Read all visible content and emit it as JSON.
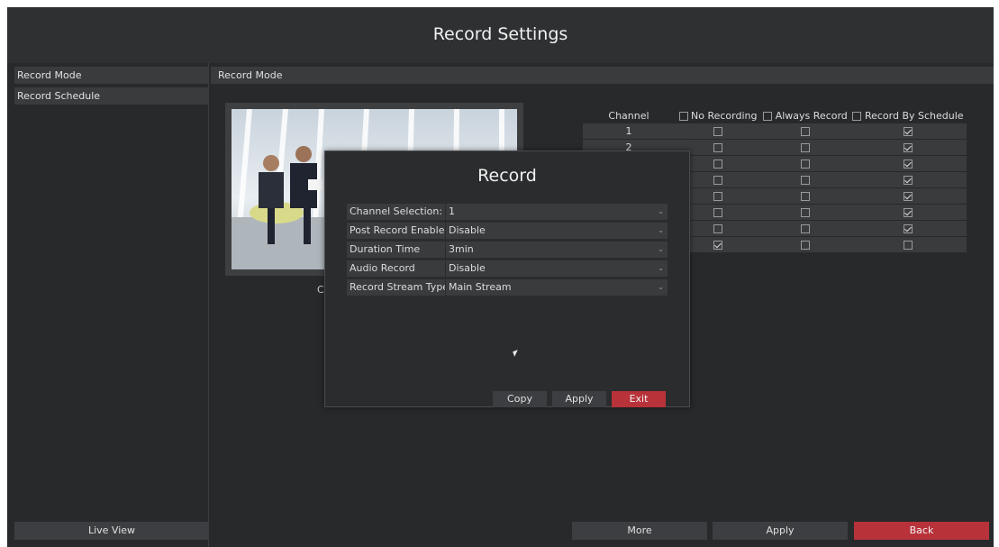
{
  "window": {
    "title": "Record Settings"
  },
  "sidebar": {
    "items": [
      {
        "label": "Record Mode"
      },
      {
        "label": "Record Schedule"
      }
    ],
    "live_view_label": "Live View"
  },
  "panel": {
    "header": "Record Mode",
    "preview_caption": "C"
  },
  "channel_table": {
    "headers": {
      "channel": "Channel",
      "no_recording": "No Recording",
      "always_record": "Always Record",
      "record_by_schedule": "Record By Schedule"
    },
    "rows": [
      {
        "channel": "1",
        "no_recording": false,
        "always_record": false,
        "record_by_schedule": true
      },
      {
        "channel": "2",
        "no_recording": false,
        "always_record": false,
        "record_by_schedule": true
      },
      {
        "channel": "",
        "no_recording": false,
        "always_record": false,
        "record_by_schedule": true
      },
      {
        "channel": "",
        "no_recording": false,
        "always_record": false,
        "record_by_schedule": true
      },
      {
        "channel": "",
        "no_recording": false,
        "always_record": false,
        "record_by_schedule": true
      },
      {
        "channel": "",
        "no_recording": false,
        "always_record": false,
        "record_by_schedule": true
      },
      {
        "channel": "",
        "no_recording": false,
        "always_record": false,
        "record_by_schedule": true
      },
      {
        "channel": "",
        "no_recording": true,
        "always_record": false,
        "record_by_schedule": false
      }
    ]
  },
  "dialog": {
    "title": "Record",
    "fields": [
      {
        "label": "Channel Selection:",
        "value": "1"
      },
      {
        "label": "Post Record Enable",
        "value": "Disable"
      },
      {
        "label": "Duration Time",
        "value": "3min"
      },
      {
        "label": "Audio Record",
        "value": "Disable"
      },
      {
        "label": "Record Stream Type",
        "value": "Main Stream"
      }
    ],
    "copy_label": "Copy",
    "apply_label": "Apply",
    "exit_label": "Exit"
  },
  "footer": {
    "more_label": "More",
    "apply_label": "Apply",
    "back_label": "Back"
  },
  "colors": {
    "accent_red": "#b8323a",
    "background": "#28292b",
    "panel": "#3a3b3d"
  }
}
